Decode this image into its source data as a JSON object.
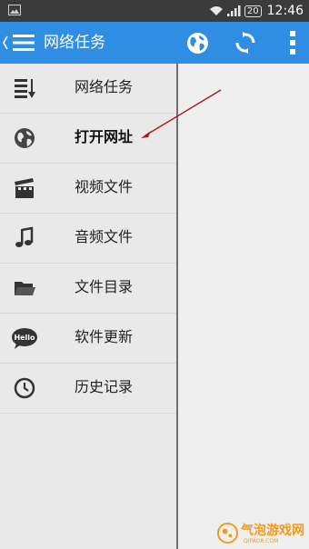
{
  "status_bar": {
    "battery": "20",
    "time": "12:46"
  },
  "app_bar": {
    "title": "网络任务",
    "icons": [
      "back-chevron-icon",
      "hamburger-icon",
      "globe-icon",
      "refresh-icon",
      "more-vert-icon"
    ],
    "color": "#2f8de4"
  },
  "drawer": {
    "items": [
      {
        "label": "网络任务",
        "icon": "task-list-icon",
        "active": false
      },
      {
        "label": "打开网址",
        "icon": "globe-icon",
        "active": true
      },
      {
        "label": "视频文件",
        "icon": "video-clapper-icon",
        "active": false
      },
      {
        "label": "音频文件",
        "icon": "music-note-icon",
        "active": false
      },
      {
        "label": "文件目录",
        "icon": "folder-icon",
        "active": false
      },
      {
        "label": "软件更新",
        "icon": "hello-bubble-icon",
        "active": false
      },
      {
        "label": "历史记录",
        "icon": "clock-icon",
        "active": false
      }
    ]
  },
  "hello_icon_text": "Hello",
  "watermark": {
    "text": "气泡游戏网",
    "sub": "QIPAO8.COM",
    "color": "#f29a1f"
  },
  "annotation_color": "#b01818"
}
